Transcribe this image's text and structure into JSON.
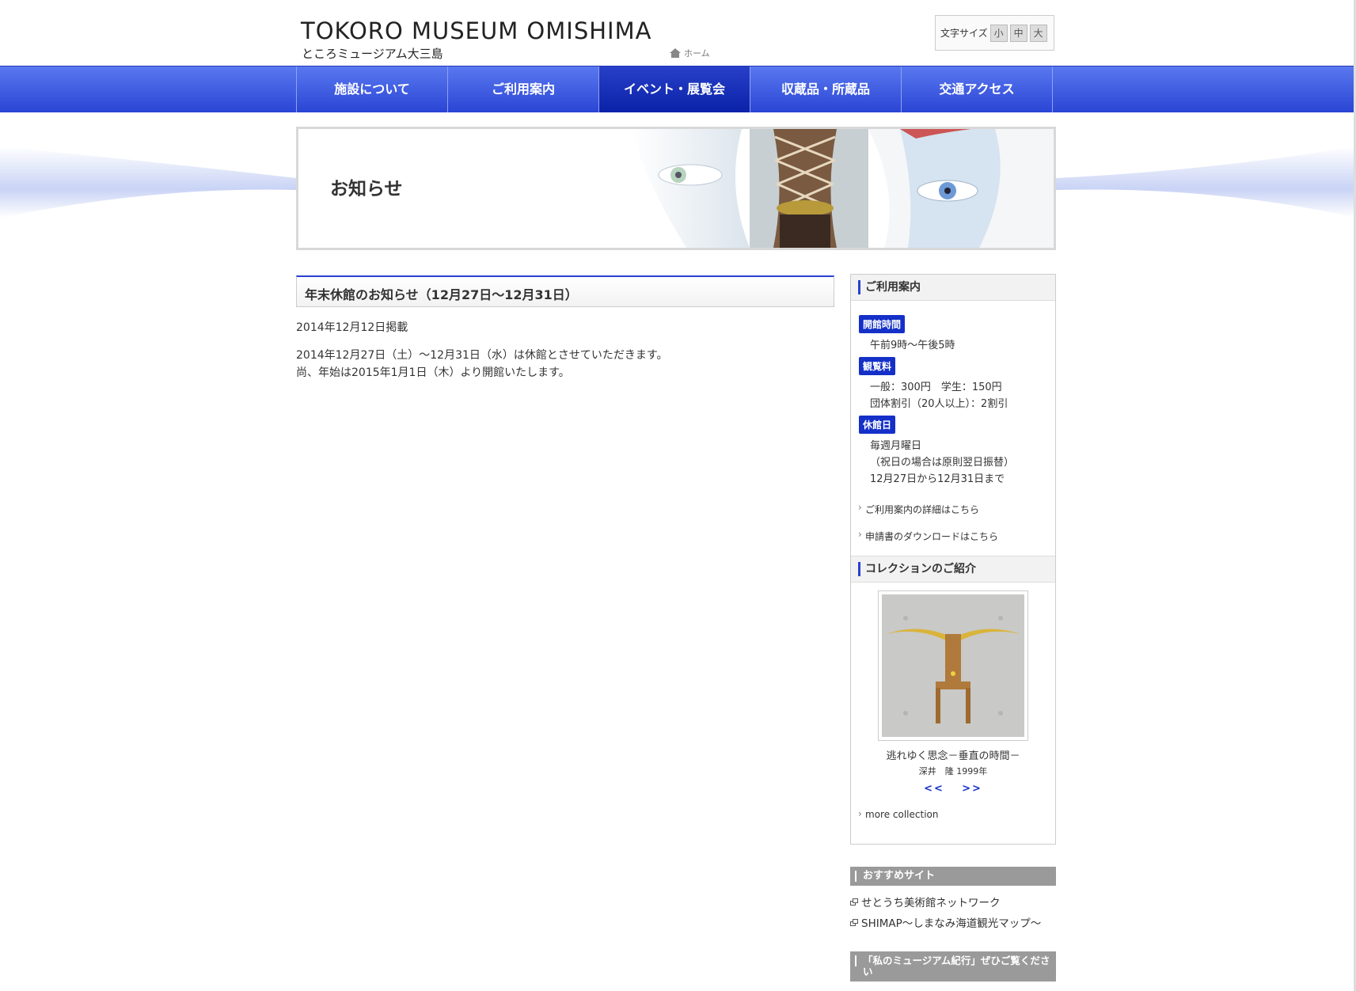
{
  "header": {
    "logo_en": "TOKORO MUSEUM OMISHIMA",
    "logo_jp": "ところミュージアム大三島",
    "home_label": "ホーム",
    "font_size_label": "文字サイズ",
    "font_sizes": [
      "小",
      "中",
      "大"
    ]
  },
  "nav": {
    "items": [
      {
        "label": "施設について"
      },
      {
        "label": "ご利用案内"
      },
      {
        "label": "イベント・展覧会"
      },
      {
        "label": "収蔵品・所蔵品"
      },
      {
        "label": "交通アクセス"
      }
    ]
  },
  "banner": {
    "title": "お知らせ"
  },
  "article": {
    "title": "年末休館のお知らせ（12月27日〜12月31日）",
    "date": "2014年12月12日掲載",
    "body_line1": "2014年12月27日（土）〜12月31日（水）は休館とさせていただきます。",
    "body_line2": "尚、年始は2015年1月1日（木）より開館いたします。"
  },
  "sidebar": {
    "guide": {
      "heading": "ご利用案内",
      "hours_tag": "開館時間",
      "hours": "午前9時〜午後5時",
      "fee_tag": "観覧料",
      "fee_line1": "一般：300円　学生：150円",
      "fee_line2": "団体割引（20人以上）：2割引",
      "closed_tag": "休館日",
      "closed_line1": "毎週月曜日",
      "closed_line2": "（祝日の場合は原則翌日振替）",
      "closed_line3": "12月27日から12月31日まで",
      "link_details": "ご利用案内の詳細はこちら",
      "link_download": "申請書のダウンロードはこちら"
    },
    "collection": {
      "heading": "コレクションのご紹介",
      "work_title": "逃れゆく思念－垂直の時間－",
      "work_artist": "深井　隆 1999年",
      "prev": "<<",
      "next": ">>",
      "more": "more collection"
    },
    "recommended": {
      "heading": "おすすめサイト",
      "links": [
        "せとうち美術館ネットワーク",
        "SHIMAP〜しまなみ海道観光マップ〜"
      ]
    },
    "museum_kiko": {
      "heading": "「私のミュージアム紀行」ぜひご覧ください"
    }
  },
  "colors": {
    "nav_blue": "#3a55dc",
    "tag_blue": "#1430c8",
    "accent": "#2a40d0"
  }
}
